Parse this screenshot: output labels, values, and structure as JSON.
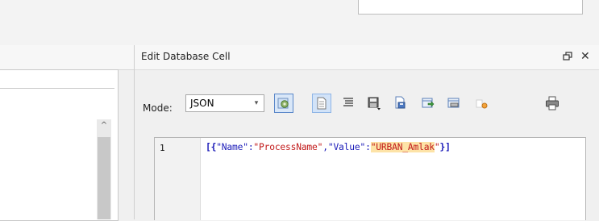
{
  "window": {
    "panel_title": "Edit Database Cell"
  },
  "header_controls": {
    "float_icon": "float-window-icon",
    "close_glyph": "✕"
  },
  "mode": {
    "label": "Mode:",
    "value": "JSON",
    "arrow": "▾"
  },
  "toolbar": {
    "icons": [
      "apply-icon",
      "text-mode-icon",
      "auto-format-icon",
      "save-icon",
      "export-icon",
      "import-icon",
      "set-null-icon",
      "image-icon",
      "print-icon"
    ]
  },
  "scroll": {
    "up_glyph": "^"
  },
  "editor": {
    "line_number": "1",
    "tokens": {
      "open": "[{",
      "k1": "\"Name\"",
      "colon1": ":",
      "v1": "\"ProcessName\"",
      "comma": ",",
      "k2": "\"Value\"",
      "colon2": ":",
      "q_open": "\"",
      "v2": "URBAN_Amlak",
      "q_close": "\"",
      "close": "}]"
    }
  },
  "colors": {
    "keyword": "#1a1ab8",
    "string": "#c21a1a",
    "highlight": "#fde3a7",
    "accent": "#5a87c9"
  }
}
